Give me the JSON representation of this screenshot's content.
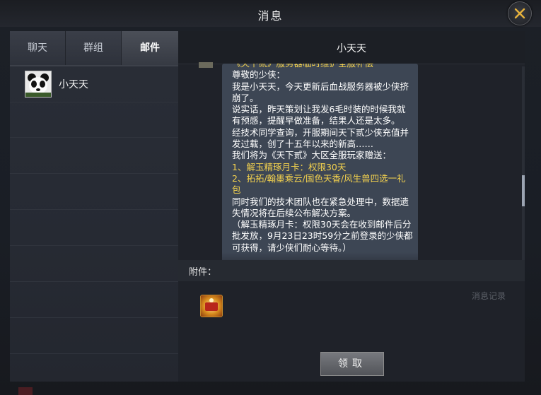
{
  "window": {
    "title": "消息"
  },
  "tabs": [
    {
      "label": "聊天",
      "active": false
    },
    {
      "label": "群组",
      "active": false
    },
    {
      "label": "邮件",
      "active": true
    }
  ],
  "contacts": [
    {
      "name": "小天天",
      "avatar": "panda-avatar-icon"
    }
  ],
  "conversation": {
    "title": "小天天",
    "message": {
      "subject": "《天下贰》服务器临时维护全服补偿",
      "paragraphs": [
        "尊敬的少侠：",
        "我是小天天，今天更新后血战服务器被少侠挤崩了。",
        "说实话，昨天策划让我发6毛时装的时候我就有预感，提醒早做准备，结果人还是太多。",
        "经技术同学查询，开服期间天下贰少侠充值并发过载，创了十五年以来的新高……",
        "我们将为《天下贰》大区全服玩家赠送："
      ],
      "rewards": [
        "1、解玉精琢月卡：权限30天",
        "2、拓拓/翰墨乘云/国色天香/风生兽四选一礼包"
      ],
      "closing": [
        "同时我们的技术团队也在紧急处理中，数据遗失情况将在后续公布解决方案。",
        "（解玉精琢月卡：权限30天会在收到邮件后分批发放，9月23日23时59分之前登录的少侠都可获得，请少侠们耐心等待。）"
      ]
    },
    "attachment_label": "附件：",
    "history_link": "消息记录",
    "attachment_item": "gift-pack-icon",
    "claim_button": "领取"
  },
  "colors": {
    "highlight_text": "#f5d34e",
    "bubble": "#3d4654",
    "accent": "#e6b23c"
  }
}
